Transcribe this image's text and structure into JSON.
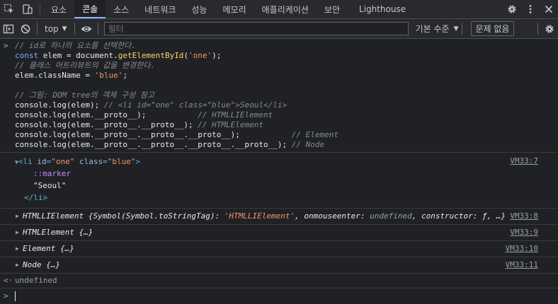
{
  "tabs": {
    "items": [
      "요소",
      "콘솔",
      "소스",
      "네트워크",
      "성능",
      "메모리",
      "애플리케이션",
      "보안",
      "Lighthouse"
    ],
    "active": "콘솔"
  },
  "toolbar": {
    "context": "top",
    "filter_placeholder": "필터",
    "levels": "기본 수준",
    "issues": "문제 없음"
  },
  "code": {
    "comment1": "// id로 하나의 요소를 선택한다.",
    "line_const": "const",
    "line_elem": " elem = document.",
    "line_fn": "getElementById",
    "line_open": "(",
    "line_arg": "'one'",
    "line_close": ");",
    "comment2": "// 클래스 어트리뷰트의 값을 변경한다.",
    "assign_left": "elem.className = ",
    "assign_val": "'blue'",
    "assign_end": ";",
    "comment3": "// 그림: DOM tree의 객체 구성 참고",
    "log1": "console.log(elem);",
    "log1_cm": " // <li id=\"one\" class=\"blue\">Seoul</li>",
    "log2": "console.log(elem.__proto__);",
    "log2_cm": "           // HTMLLIElement",
    "log3": "console.log(elem.__proto__.__proto__);",
    "log3_cm": " // HTMLElement",
    "log4": "console.log(elem.__proto__.__proto__.__proto__);",
    "log4_cm": "           // Element",
    "log5": "console.log(elem.__proto__.__proto__.__proto__.__proto__);",
    "log5_cm": " // Node"
  },
  "output": {
    "li": {
      "open_tag": "<li",
      "id_attr": " id",
      "id_val": "\"one\"",
      "class_attr": " class",
      "class_val": "\"blue\"",
      "close": ">",
      "marker": "::marker",
      "text": "\"Seoul\"",
      "end_tag": "</li>",
      "source": "VM33:7"
    },
    "rows": [
      {
        "label": "HTMLLIElement",
        "rest_open": " {Symbol(Symbol.toStringTag): ",
        "rest_str": "'HTMLLIElement'",
        "rest_after": ", onmouseenter: ",
        "rest_undef": "undefined",
        "rest_tail": ", constructor: ƒ, …}",
        "source": "VM33:8"
      },
      {
        "label": "HTMLElement",
        "rest": " {…}",
        "source": "VM33:9"
      },
      {
        "label": "Element",
        "rest": " {…}",
        "source": "VM33:10"
      },
      {
        "label": "Node",
        "rest": " {…}",
        "source": "VM33:11"
      }
    ],
    "result": "undefined"
  },
  "colors": {
    "accent": "#8ab4f8",
    "background": "#202124",
    "toolbar": "#292a2d"
  },
  "icons": [
    "inspect-icon",
    "device-toggle-icon",
    "gear-icon",
    "more-vert-icon",
    "close-icon",
    "sidebar-toggle-icon",
    "clear-icon",
    "eye-icon",
    "settings-icon"
  ]
}
